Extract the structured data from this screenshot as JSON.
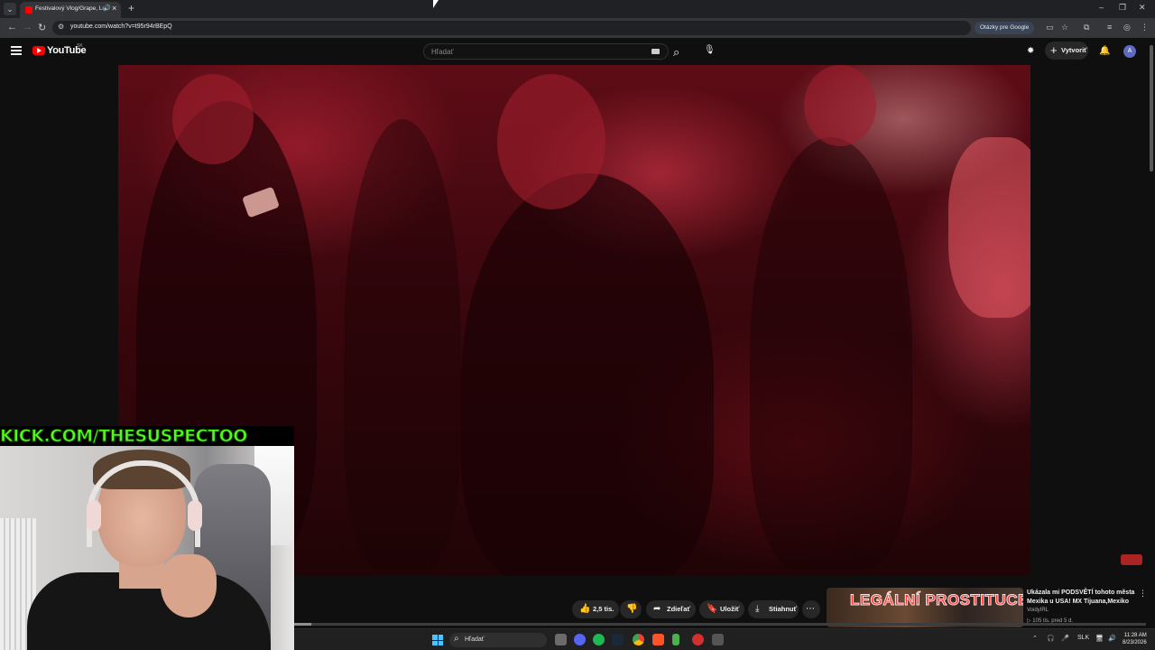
{
  "browser": {
    "tab_title": "Festivalový Vlog/Grape, Lo...",
    "url": "youtube.com/watch?v=t95r94rBEpQ",
    "google_questions": "Otázky pre Google",
    "new_tab": "+",
    "tab_close": "×",
    "win_minimize": "–",
    "win_restore": "❐",
    "win_close": "✕"
  },
  "youtube": {
    "logo_text": "YouTube",
    "country_code": "SK",
    "search_placeholder": "Hľadať",
    "create_label": "Vytvoriť",
    "avatar_letter": "A"
  },
  "stream_overlay": {
    "kick_text": "KICK.COM/THESUSPECTOO"
  },
  "actions": {
    "likes": "2,5 tis.",
    "share": "Zdieľať",
    "save": "Uložiť",
    "download": "Stiahnuť"
  },
  "recommended": {
    "thumb_text": "LEGÁLNÍ PROSTITUCE",
    "title": "Ukázala mi PODSVĚTÍ tohoto města Mexika u USA! MX Tijuana,Mexiko",
    "channel": "VoidyIRL",
    "meta": "▷ 105 tis.  pred 5 d."
  },
  "player": {
    "progress_fraction": 0.02
  },
  "taskbar": {
    "search_label": "Hľadať",
    "language": "SLK",
    "time": "11:28 AM",
    "date": "8/23/2026"
  },
  "icons": {
    "back": "back-arrow-icon",
    "forward": "forward-arrow-icon",
    "reload": "reload-icon",
    "like": "thumbs-up-icon",
    "dislike": "thumbs-down-icon",
    "share": "share-arrow-icon",
    "save": "bookmark-icon",
    "download": "download-icon",
    "more": "more-horizontal-icon"
  },
  "colors": {
    "yt_red": "#ff0000",
    "kick_green": "#53fc18",
    "background": "#0f0f0f"
  }
}
